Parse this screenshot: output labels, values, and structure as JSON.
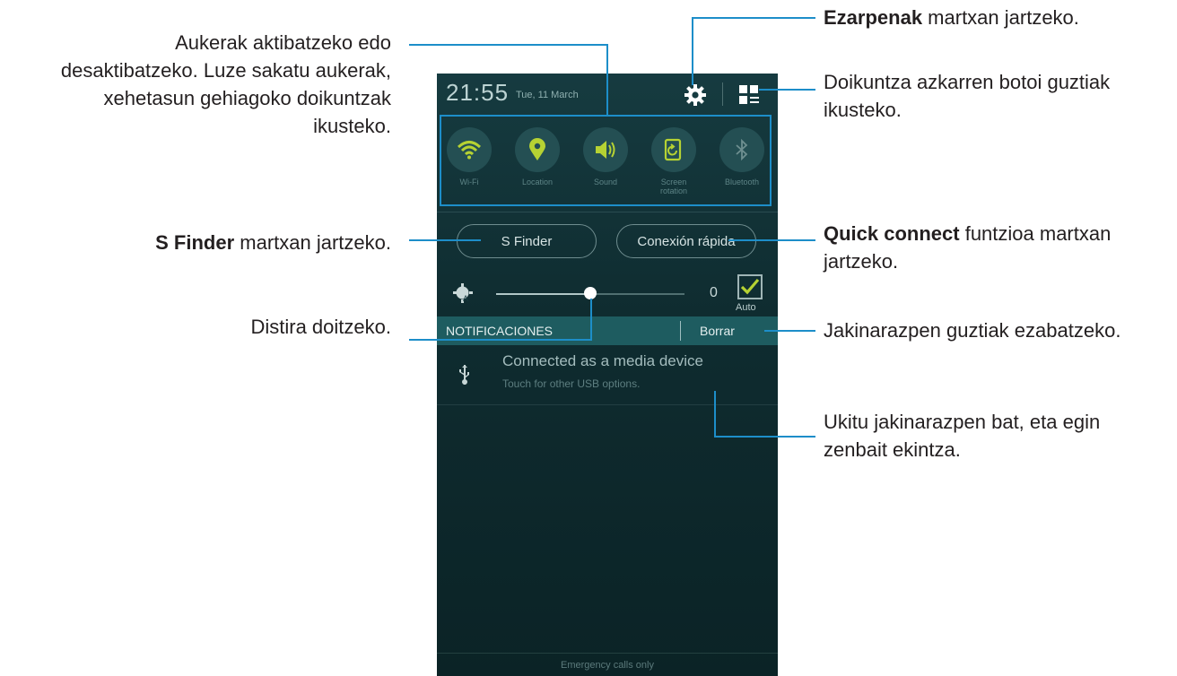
{
  "annotations": {
    "toggles": [
      "Aukerak aktibatzeko edo",
      "desaktibatzeko. Luze sakatu aukerak,",
      "xehetasun gehiagoko doikuntzak",
      "ikusteko."
    ],
    "settings_bold": "Ezarpenak",
    "settings_rest": " martxan jartzeko.",
    "quick_settings": [
      "Doikuntza azkarren botoi guztiak",
      "ikusteko."
    ],
    "sfinder_bold": "S Finder",
    "sfinder_rest": " martxan jartzeko.",
    "quickconnect_bold": "Quick connect",
    "quickconnect_rest": " funtzioa martxan",
    "quickconnect_line2": "jartzeko.",
    "clear": "Jakinarazpen guztiak ezabatzeko.",
    "brightness": "Distira doitzeko.",
    "notification": [
      "Ukitu jakinarazpen bat, eta egin",
      "zenbait ekintza."
    ]
  },
  "phone": {
    "clock": "21:55",
    "date": "Tue, 11 March",
    "toggles": [
      {
        "label": "Wi-Fi",
        "icon": "wifi-icon"
      },
      {
        "label": "Location",
        "icon": "location-pin-icon"
      },
      {
        "label": "Sound",
        "icon": "sound-icon"
      },
      {
        "label": "Screen rotation",
        "icon": "screen-rotation-icon"
      },
      {
        "label": "Bluetooth",
        "icon": "bluetooth-icon"
      }
    ],
    "sfinder": "S Finder",
    "quick_connect": "Conexión rápida",
    "brightness_value": "0",
    "brightness_level": 0.5,
    "auto_label": "Auto",
    "notifications_label": "NOTIFICACIONES",
    "clear_label": "Borrar",
    "notification_title": "Connected as a media device",
    "notification_sub": "Touch for other USB options.",
    "emergency": "Emergency calls only"
  },
  "colors": {
    "accent": "#1d8ec9",
    "toggle_active": "#b6d233",
    "panel": "#143538"
  }
}
